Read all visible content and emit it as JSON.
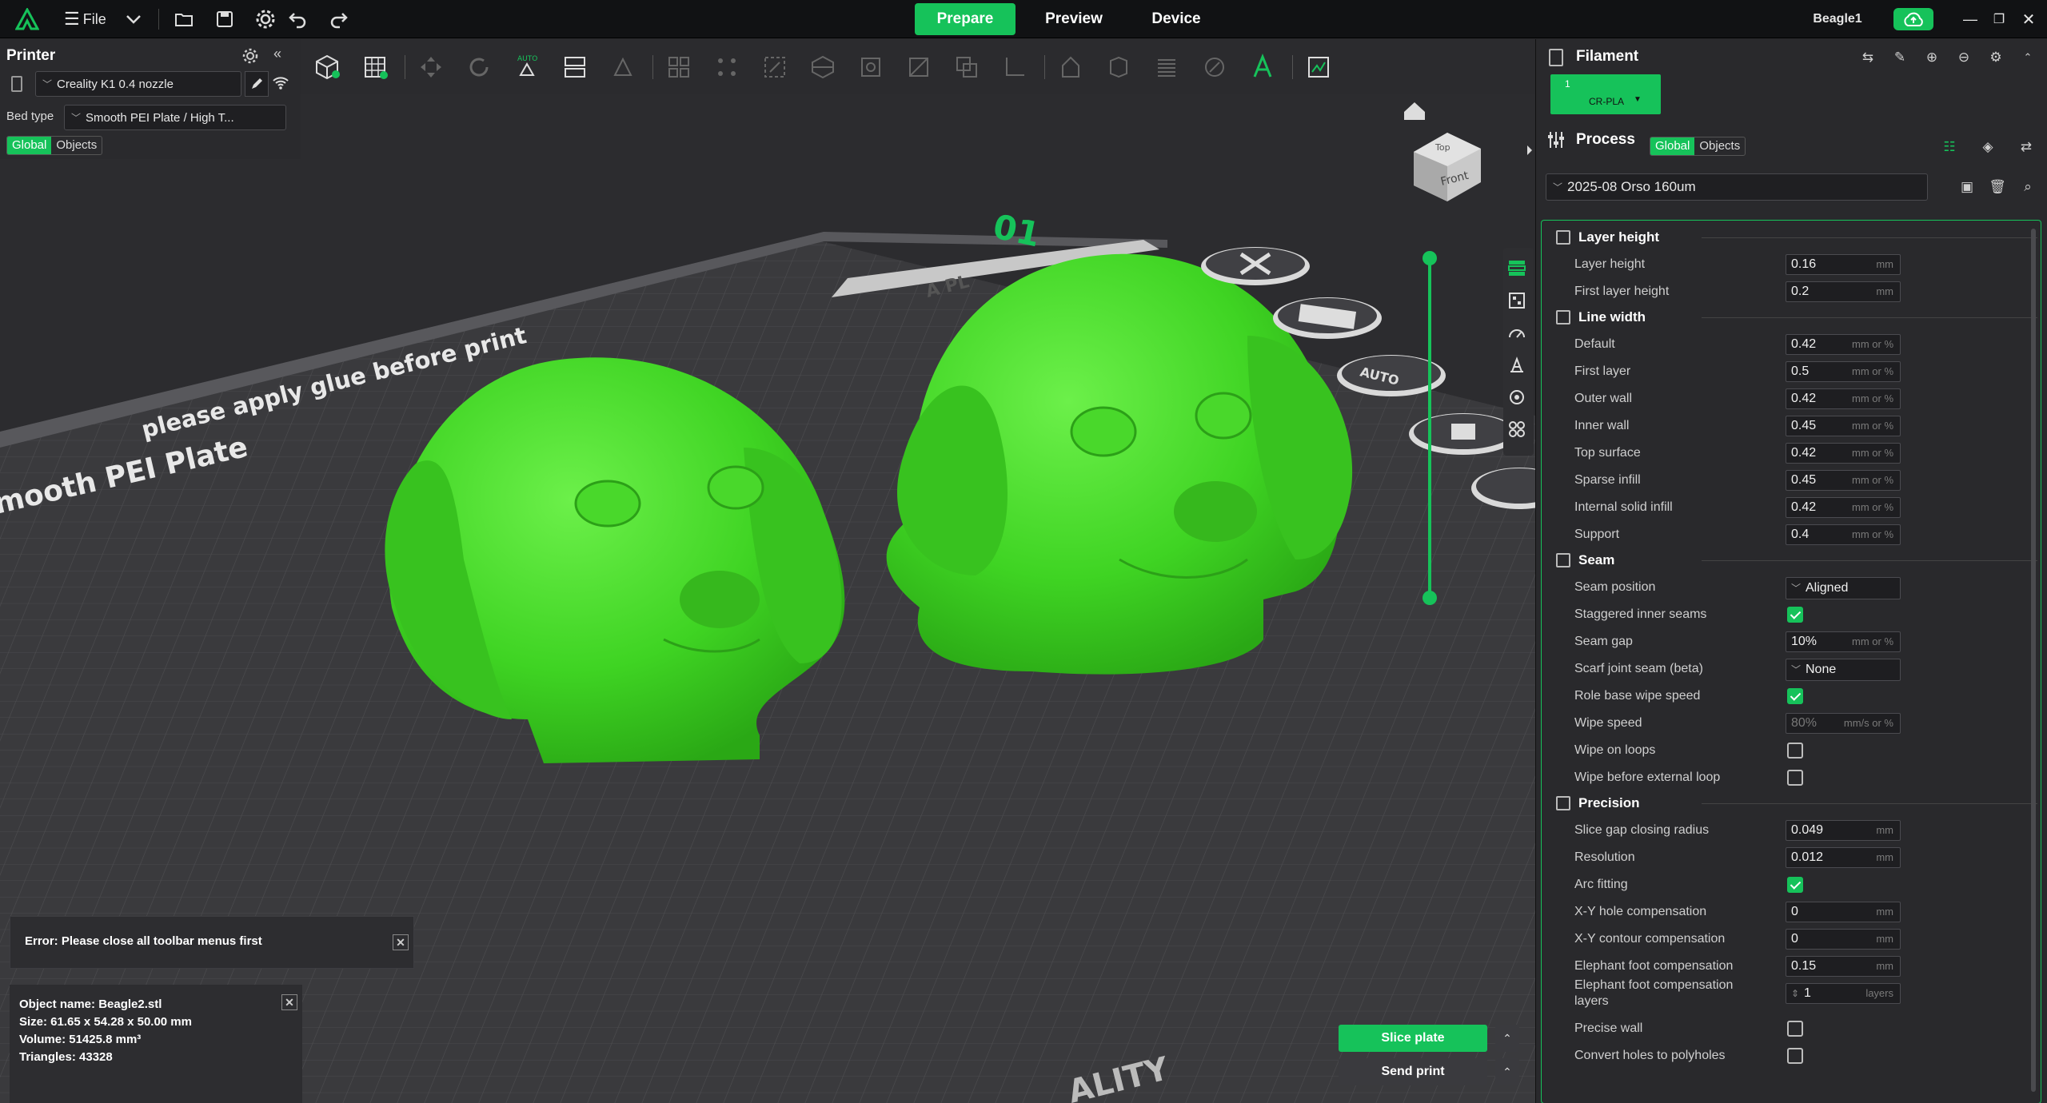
{
  "topbar": {
    "file_label": "File",
    "tabs": [
      {
        "label": "Prepare",
        "active": true
      },
      {
        "label": "Preview",
        "active": false
      },
      {
        "label": "Device",
        "active": false
      }
    ],
    "project_name": "Beagle1"
  },
  "printer": {
    "title": "Printer",
    "printer_name": "Creality K1 0.4 nozzle",
    "bed_type_label": "Bed type",
    "bed_type_value": "Smooth PEI Plate / High T...",
    "scope_tabs": [
      "Global",
      "Objects"
    ]
  },
  "viewport": {
    "plate_text_1": "please apply glue before print",
    "plate_text_2": "mooth PEI Plate",
    "plate_number": "01",
    "plate_name_partial": "A PL",
    "cube_top": "Top",
    "cube_front": "Front",
    "auto_label": "AUTO",
    "bottom_text": "ALITY"
  },
  "filament": {
    "title": "Filament",
    "slot_number": "1",
    "slot_name": "CR-PLA",
    "slot_color": "#16c25a"
  },
  "process": {
    "title": "Process",
    "scope_tabs": [
      "Global",
      "Objects"
    ],
    "preset": "2025-08 Orso 160um",
    "groups": [
      {
        "title": "Layer height",
        "rows": [
          {
            "label": "Layer height",
            "type": "input",
            "value": "0.16",
            "unit": "mm"
          },
          {
            "label": "First layer height",
            "type": "input",
            "value": "0.2",
            "unit": "mm"
          }
        ]
      },
      {
        "title": "Line width",
        "rows": [
          {
            "label": "Default",
            "type": "input",
            "value": "0.42",
            "unit": "mm or %"
          },
          {
            "label": "First layer",
            "type": "input",
            "value": "0.5",
            "unit": "mm or %"
          },
          {
            "label": "Outer wall",
            "type": "input",
            "value": "0.42",
            "unit": "mm or %"
          },
          {
            "label": "Inner wall",
            "type": "input",
            "value": "0.45",
            "unit": "mm or %"
          },
          {
            "label": "Top surface",
            "type": "input",
            "value": "0.42",
            "unit": "mm or %"
          },
          {
            "label": "Sparse infill",
            "type": "input",
            "value": "0.45",
            "unit": "mm or %"
          },
          {
            "label": "Internal solid infill",
            "type": "input",
            "value": "0.42",
            "unit": "mm or %"
          },
          {
            "label": "Support",
            "type": "input",
            "value": "0.4",
            "unit": "mm or %"
          }
        ]
      },
      {
        "title": "Seam",
        "rows": [
          {
            "label": "Seam position",
            "type": "select",
            "value": "Aligned"
          },
          {
            "label": "Staggered inner seams",
            "type": "check",
            "checked": true
          },
          {
            "label": "Seam gap",
            "type": "input",
            "value": "10%",
            "unit": "mm or %"
          },
          {
            "label": "Scarf joint seam (beta)",
            "type": "select",
            "value": "None"
          },
          {
            "label": "Role base wipe speed",
            "type": "check",
            "checked": true
          },
          {
            "label": "Wipe speed",
            "type": "input",
            "value": "80%",
            "unit": "mm/s or %",
            "dim": true
          },
          {
            "label": "Wipe on loops",
            "type": "check",
            "checked": false
          },
          {
            "label": "Wipe before external loop",
            "type": "check",
            "checked": false
          }
        ]
      },
      {
        "title": "Precision",
        "rows": [
          {
            "label": "Slice gap closing radius",
            "type": "input",
            "value": "0.049",
            "unit": "mm"
          },
          {
            "label": "Resolution",
            "type": "input",
            "value": "0.012",
            "unit": "mm"
          },
          {
            "label": "Arc fitting",
            "type": "check",
            "checked": true
          },
          {
            "label": "X-Y hole compensation",
            "type": "input",
            "value": "0",
            "unit": "mm"
          },
          {
            "label": "X-Y contour compensation",
            "type": "input",
            "value": "0",
            "unit": "mm"
          },
          {
            "label": "Elephant foot compensation",
            "type": "input",
            "value": "0.15",
            "unit": "mm"
          },
          {
            "label": "Elephant foot compensation layers",
            "type": "spin",
            "value": "1",
            "unit": "layers"
          },
          {
            "label": "Precise wall",
            "type": "check",
            "checked": false
          },
          {
            "label": "Convert holes to polyholes",
            "type": "check",
            "checked": false
          }
        ]
      }
    ]
  },
  "error": {
    "message": "Error: Please close all toolbar menus first"
  },
  "object_info": {
    "name": "Object name: Beagle2.stl",
    "size": "Size: 61.65 x 54.28 x 50.00 mm",
    "volume": "Volume: 51425.8 mm³",
    "triangles": "Triangles: 43328"
  },
  "actions": {
    "slice_label": "Slice plate",
    "send_label": "Send print"
  },
  "colors": {
    "accent": "#16c25a",
    "model": "#52e02e"
  }
}
